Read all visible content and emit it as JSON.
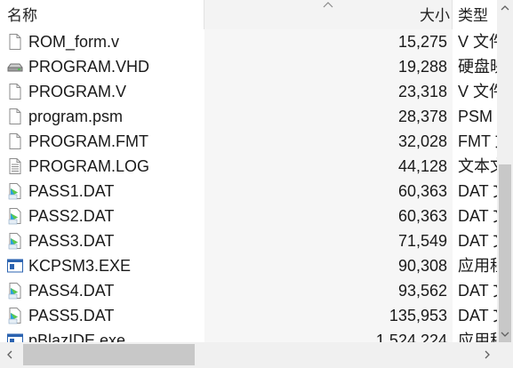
{
  "columns": {
    "name": "名称",
    "size": "大小",
    "type": "类型"
  },
  "sort": {
    "column": "size",
    "direction": "ascending"
  },
  "files": [
    {
      "name": "ROM_form.v",
      "size": "15,275",
      "type": "V 文件",
      "icon": "generic-file-icon"
    },
    {
      "name": "PROGRAM.VHD",
      "size": "19,288",
      "type": "硬盘映像",
      "icon": "disk-image-icon"
    },
    {
      "name": "PROGRAM.V",
      "size": "23,318",
      "type": "V 文件",
      "icon": "generic-file-icon"
    },
    {
      "name": "program.psm",
      "size": "28,378",
      "type": "PSM 文件",
      "icon": "generic-file-icon"
    },
    {
      "name": "PROGRAM.FMT",
      "size": "32,028",
      "type": "FMT 文件",
      "icon": "generic-file-icon"
    },
    {
      "name": "PROGRAM.LOG",
      "size": "44,128",
      "type": "文本文档",
      "icon": "text-document-icon"
    },
    {
      "name": "PASS1.DAT",
      "size": "60,363",
      "type": "DAT 文件",
      "icon": "media-file-icon"
    },
    {
      "name": "PASS2.DAT",
      "size": "60,363",
      "type": "DAT 文件",
      "icon": "media-file-icon"
    },
    {
      "name": "PASS3.DAT",
      "size": "71,549",
      "type": "DAT 文件",
      "icon": "media-file-icon"
    },
    {
      "name": "KCPSM3.EXE",
      "size": "90,308",
      "type": "应用程序",
      "icon": "application-icon"
    },
    {
      "name": "PASS4.DAT",
      "size": "93,562",
      "type": "DAT 文件",
      "icon": "media-file-icon"
    },
    {
      "name": "PASS5.DAT",
      "size": "135,953",
      "type": "DAT 文件",
      "icon": "media-file-icon"
    },
    {
      "name": "pBlazIDE.exe",
      "size": "1,524,224",
      "type": "应用程序",
      "icon": "application-icon"
    }
  ]
}
